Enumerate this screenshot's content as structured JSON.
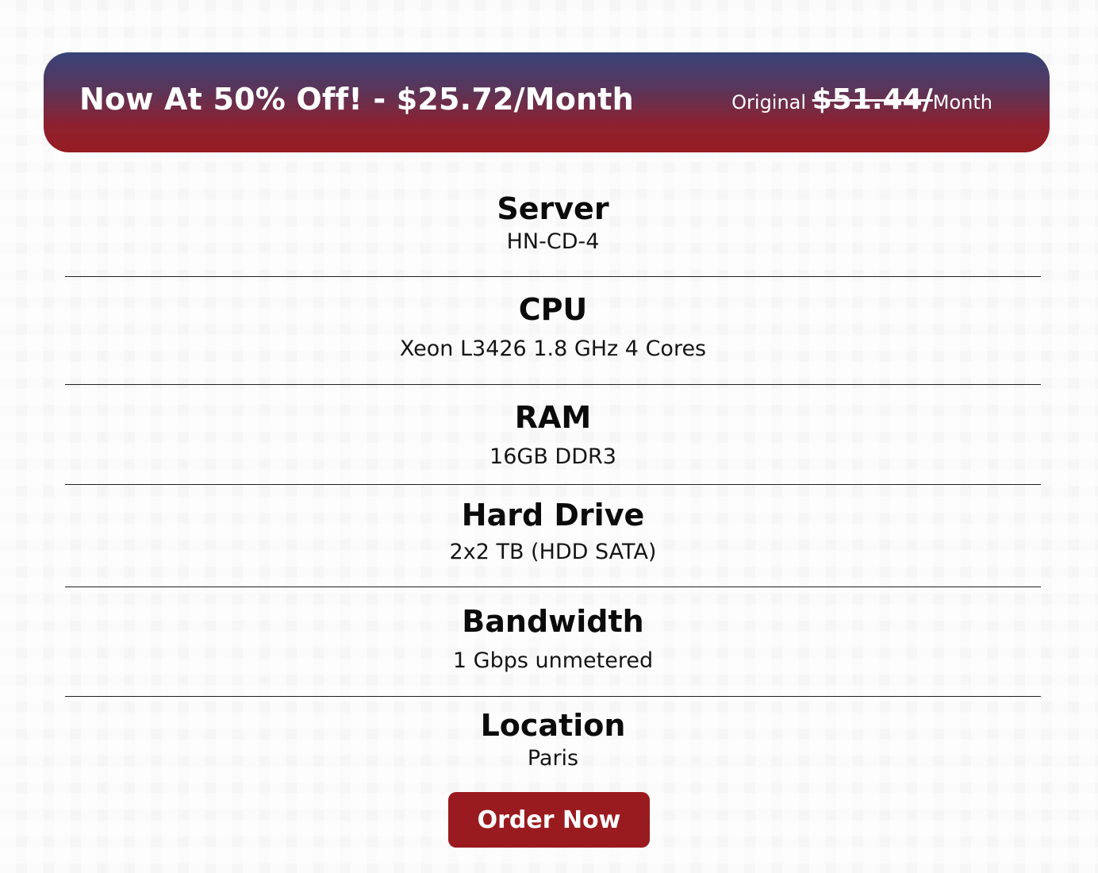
{
  "banner": {
    "headline": "Now At 50% Off! - $25.72/Month",
    "original_prefix": "Original ",
    "original_price": "$51.44/",
    "original_suffix": "Month"
  },
  "specs": [
    {
      "label": "Server",
      "value": "HN-CD-4"
    },
    {
      "label": "CPU",
      "value": "Xeon L3426 1.8 GHz 4 Cores"
    },
    {
      "label": "RAM",
      "value": "16GB DDR3"
    },
    {
      "label": "Hard Drive",
      "value": "2x2 TB (HDD SATA)"
    },
    {
      "label": "Bandwidth",
      "value": "1 Gbps unmetered"
    },
    {
      "label": "Location",
      "value": "Paris"
    }
  ],
  "order_button": {
    "label": "Order Now"
  },
  "colors": {
    "banner_top": "#364377",
    "banner_bottom": "#961c22",
    "button": "#991b1f"
  }
}
